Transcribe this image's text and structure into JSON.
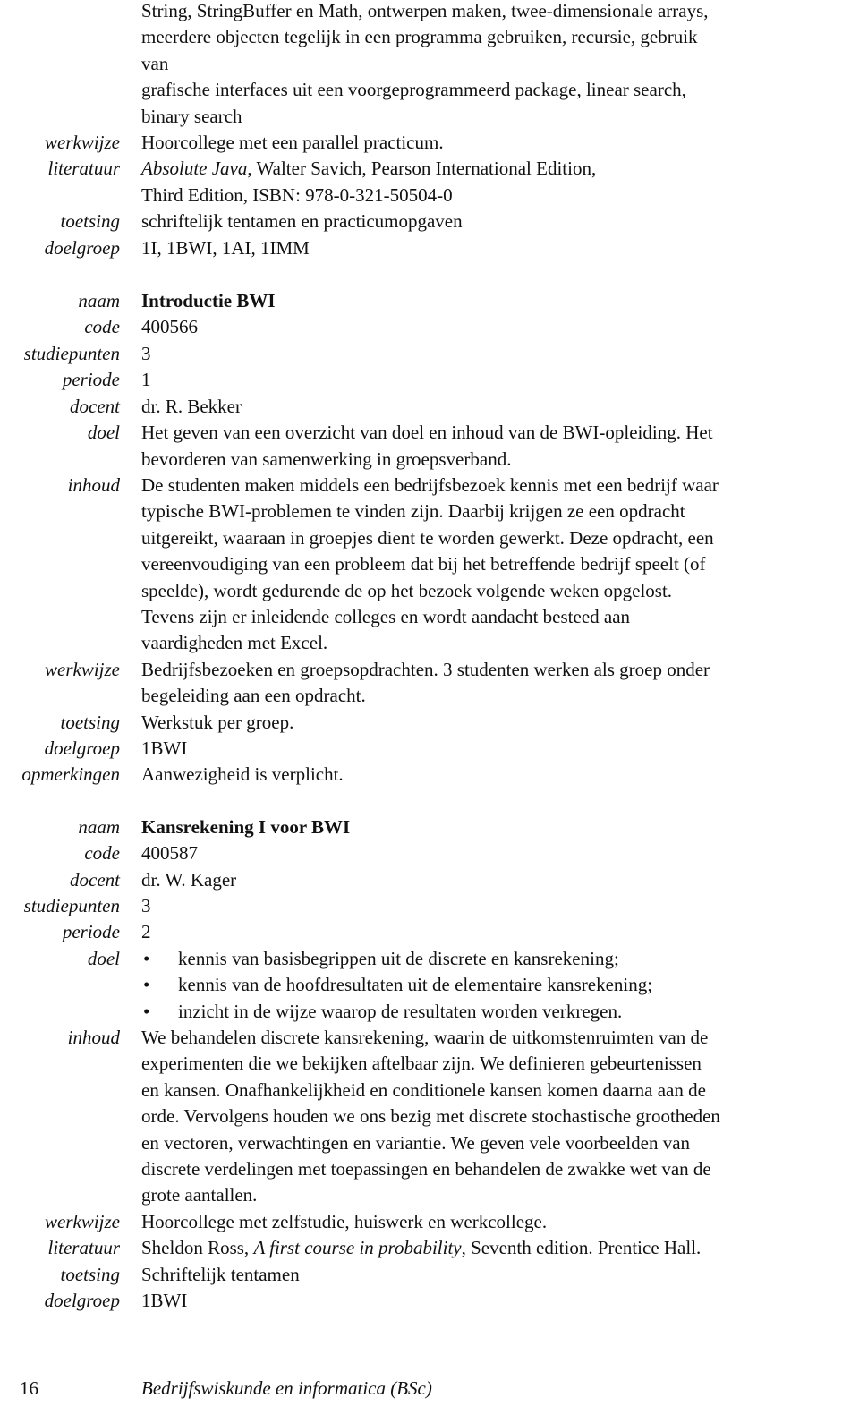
{
  "previous_course": {
    "inhoud_continuation": [
      "String, StringBuffer en Math, ontwerpen maken, twee-dimensionale arrays,",
      "meerdere objecten tegelijk in een programma gebruiken, recursie, gebruik",
      "van",
      "grafische interfaces uit een voorgeprogrammeerd package, linear search,",
      "binary search"
    ],
    "werkwijze": {
      "label": "werkwijze",
      "value": "Hoorcollege met een parallel practicum."
    },
    "literatuur": {
      "label": "literatuur",
      "title": "Absolute Java",
      "rest_line1": ", Walter Savich, Pearson International Edition,",
      "line2": "Third Edition, ISBN: 978-0-321-50504-0"
    },
    "toetsing": {
      "label": "toetsing",
      "value": "schriftelijk tentamen en practicumopgaven"
    },
    "doelgroep": {
      "label": "doelgroep",
      "value": "1I, 1BWI, 1AI, 1IMM"
    }
  },
  "course_introductie": {
    "naam": {
      "label": "naam",
      "value": "Introductie BWI"
    },
    "code": {
      "label": "code",
      "value": "400566"
    },
    "studiepunten": {
      "label": "studiepunten",
      "value": "3"
    },
    "periode": {
      "label": "periode",
      "value": "1"
    },
    "docent": {
      "label": "docent",
      "value": "dr. R. Bekker"
    },
    "doel": {
      "label": "doel",
      "lines": [
        "Het geven van een overzicht van doel en inhoud van de BWI-opleiding. Het",
        "bevorderen van samenwerking in groepsverband."
      ]
    },
    "inhoud": {
      "label": "inhoud",
      "lines": [
        "De studenten maken middels een bedrijfsbezoek kennis met een bedrijf waar",
        "typische BWI-problemen te vinden zijn. Daarbij krijgen ze een opdracht",
        "uitgereikt, waaraan in groepjes dient te worden gewerkt. Deze opdracht, een",
        "vereenvoudiging van een probleem dat bij het betreffende bedrijf speelt (of",
        "speelde), wordt gedurende de op het bezoek volgende weken opgelost.",
        "Tevens zijn er inleidende colleges en wordt aandacht besteed aan",
        "vaardigheden met Excel."
      ]
    },
    "werkwijze": {
      "label": "werkwijze",
      "lines": [
        "Bedrijfsbezoeken en groepsopdrachten. 3 studenten werken als groep onder",
        "begeleiding aan een opdracht."
      ]
    },
    "toetsing": {
      "label": "toetsing",
      "value": "Werkstuk per groep."
    },
    "doelgroep": {
      "label": "doelgroep",
      "value": "1BWI"
    },
    "opmerkingen": {
      "label": "opmerkingen",
      "value": "Aanwezigheid is verplicht."
    }
  },
  "course_kansrekening": {
    "naam": {
      "label": "naam",
      "value": "Kansrekening I voor BWI"
    },
    "code": {
      "label": "code",
      "value": "400587"
    },
    "docent": {
      "label": "docent",
      "value": "dr. W. Kager"
    },
    "studiepunten": {
      "label": "studiepunten",
      "value": "3"
    },
    "periode": {
      "label": "periode",
      "value": "2"
    },
    "doel": {
      "label": "doel",
      "bullet": "•",
      "items": [
        "kennis van basisbegrippen uit de discrete en kansrekening;",
        "kennis van de hoofdresultaten uit de elementaire kansrekening;",
        "inzicht in de wijze waarop de resultaten worden verkregen."
      ]
    },
    "inhoud": {
      "label": "inhoud",
      "lines": [
        "We behandelen discrete kansrekening, waarin de uitkomstenruimten van de",
        "experimenten die we bekijken aftelbaar zijn. We definieren gebeurtenissen",
        "en kansen. Onafhankelijkheid en conditionele kansen komen daarna aan de",
        "orde. Vervolgens houden we ons bezig met discrete stochastische grootheden",
        "en vectoren, verwachtingen en variantie. We geven vele voorbeelden van",
        "discrete verdelingen met toepassingen en behandelen de zwakke wet van de",
        "grote aantallen."
      ]
    },
    "werkwijze": {
      "label": "werkwijze",
      "value": "Hoorcollege met zelfstudie, huiswerk en werkcollege."
    },
    "literatuur": {
      "label": "literatuur",
      "author": "Sheldon Ross, ",
      "title": "A first course in probability",
      "rest": ", Seventh edition. Prentice Hall."
    },
    "toetsing": {
      "label": "toetsing",
      "value": "Schriftelijk tentamen"
    },
    "doelgroep": {
      "label": "doelgroep",
      "value": "1BWI"
    }
  },
  "footer": {
    "page_number": "16",
    "title": "Bedrijfswiskunde en informatica (BSc)"
  }
}
